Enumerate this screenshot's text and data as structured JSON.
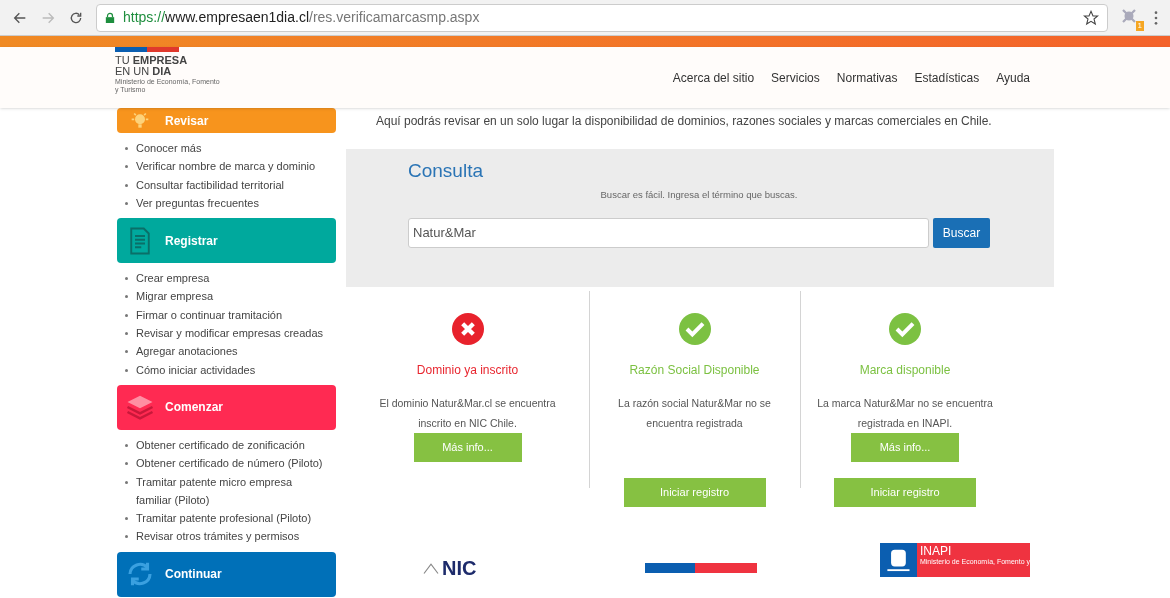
{
  "browser": {
    "url_scheme": "https://",
    "url_host": "www.empresaen1dia.cl",
    "url_path": "/res.verificamarcasmp.aspx",
    "extension_badge": "1"
  },
  "header": {
    "logo_line1": "TU **EMPRESA**",
    "logo_line2": "EN UN **DIA**",
    "logo_sub": "Ministerio de Economía, Fomento y Turismo",
    "nav": [
      "Acerca del sitio",
      "Servicios",
      "Normativas",
      "Estadísticas",
      "Ayuda"
    ]
  },
  "intro": "Aquí podrás revisar en un solo lugar la disponibilidad de dominios, razones sociales y marcas comerciales en Chile.",
  "sidebar": [
    {
      "title": "Revisar",
      "color": "#f7941d",
      "kind": "bulb",
      "items": [
        "Conocer más",
        "Verificar nombre de marca y dominio",
        "Consultar factibilidad territorial",
        "Ver preguntas frecuentes"
      ]
    },
    {
      "title": "Registrar",
      "color": "#00a99d",
      "kind": "document",
      "items": [
        "Crear empresa",
        "Migrar empresa",
        "Firmar o continuar tramitación",
        "Revisar y modificar empresas creadas",
        "Agregar anotaciones",
        "Cómo iniciar actividades"
      ]
    },
    {
      "title": "Comenzar",
      "color": "#ff2a52",
      "kind": "layers",
      "items": [
        "Obtener certificado de zonificación",
        "Obtener certificado de número (Piloto)",
        "Tramitar patente micro empresa familiar (Piloto)",
        "Tramitar patente profesional (Piloto)",
        "Revisar otros trámites y permisos"
      ]
    },
    {
      "title": "Continuar",
      "color": "#0070b8",
      "kind": "sync"
    }
  ],
  "consulta": {
    "title": "Consulta",
    "hint": "Buscar es fácil. Ingresa el término que buscas.",
    "query": "Natur&Mar",
    "button": "Buscar"
  },
  "results": [
    {
      "available": false,
      "title": "Dominio ya inscrito",
      "text": "El dominio Natur&Mar.cl se encuentra inscrito en NIC Chile.",
      "buttons": [
        {
          "kind": "info",
          "label": "Más info..."
        }
      ]
    },
    {
      "available": true,
      "title": "Razón Social Disponible",
      "text": "La razón social Natur&Mar no se encuentra registrada",
      "buttons": [
        {
          "kind": "register",
          "label": "Iniciar registro"
        }
      ]
    },
    {
      "available": true,
      "title": "Marca disponible",
      "text": "La marca Natur&Mar no se encuentra registrada en INAPI.",
      "buttons": [
        {
          "kind": "info",
          "label": "Más info..."
        },
        {
          "kind": "register",
          "label": "Iniciar registro"
        }
      ]
    }
  ],
  "logos": [
    {
      "kind": "nic",
      "text": "NIC"
    },
    {
      "kind": "gob"
    },
    {
      "kind": "inapi",
      "text": "INAPI",
      "subtitle": "Ministerio de Economía, Fomento y"
    }
  ]
}
